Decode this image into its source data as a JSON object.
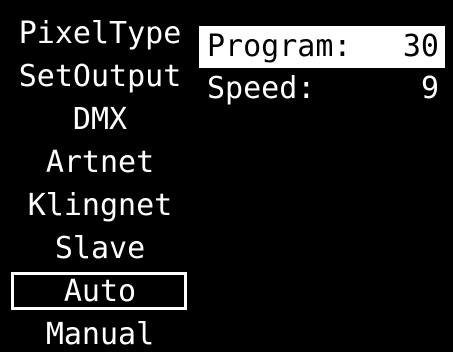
{
  "menu": {
    "items": [
      {
        "label": "PixelType"
      },
      {
        "label": "SetOutput"
      },
      {
        "label": "DMX"
      },
      {
        "label": "Artnet"
      },
      {
        "label": "Klingnet"
      },
      {
        "label": "Slave"
      },
      {
        "label": "Auto",
        "selected": true
      },
      {
        "label": "Manual"
      }
    ]
  },
  "params": {
    "program": {
      "label": "Program:",
      "value": "30",
      "highlighted": true
    },
    "speed": {
      "label": "Speed:",
      "value": "9"
    }
  },
  "colors": {
    "background": "#000000",
    "foreground": "#ffffff"
  }
}
